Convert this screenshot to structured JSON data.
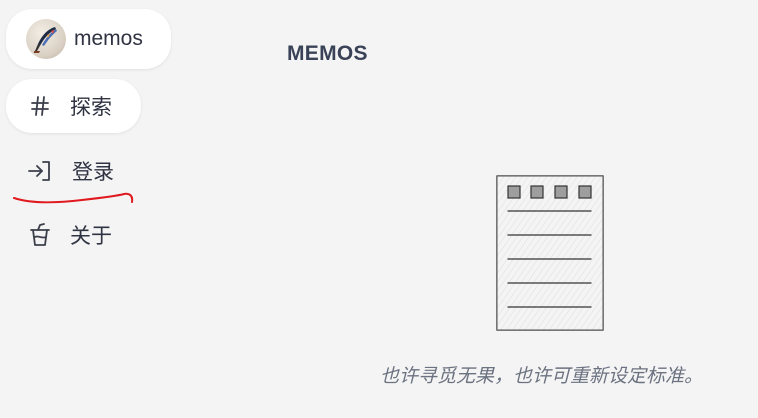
{
  "sidebar": {
    "profile": {
      "name": "memos",
      "avatar_icon": "feather-quill-avatar"
    },
    "items": [
      {
        "label": "探索",
        "icon": "hash-icon"
      },
      {
        "label": "登录",
        "icon": "sign-in-icon"
      },
      {
        "label": "关于",
        "icon": "cup-icon"
      }
    ]
  },
  "main": {
    "title": "MEMOS",
    "empty_state": {
      "message": "也许寻觅无果，也许可重新设定标准。",
      "illustration": "empty-notes-sketch-icon"
    }
  },
  "annotation": {
    "color": "#e0191f",
    "shape": "red-underline-scribble"
  },
  "colors": {
    "background": "#f4f4f4",
    "pill_background": "#ffffff",
    "text": "#2f3342",
    "muted_text": "#6b7280"
  }
}
